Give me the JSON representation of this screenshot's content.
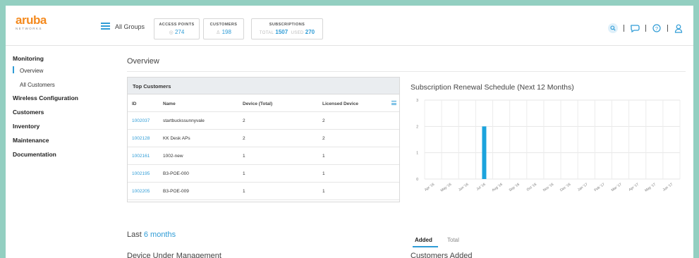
{
  "header": {
    "logo_text": "aruba",
    "logo_sub": "NETWORKS",
    "group_label": "All Groups",
    "stats": [
      {
        "title": "ACCESS POINTS",
        "value": "274"
      },
      {
        "title": "CUSTOMERS",
        "value": "198"
      },
      {
        "title": "SUBSCRIPTIONS",
        "total_label": "TOTAL",
        "total": "1507",
        "used_label": "USED",
        "used": "270"
      }
    ],
    "icons": [
      "search-icon",
      "chat-icon",
      "help-icon",
      "user-icon"
    ],
    "accent": "#2f9cd6",
    "brand": "#f48a1e"
  },
  "sidebar": {
    "sections": [
      {
        "label": "Monitoring",
        "items": [
          {
            "label": "Overview",
            "active": true
          },
          {
            "label": "All Customers",
            "active": false
          }
        ]
      },
      {
        "label": "Wireless Configuration",
        "items": []
      },
      {
        "label": "Customers",
        "items": []
      },
      {
        "label": "Inventory",
        "items": []
      },
      {
        "label": "Maintenance",
        "items": []
      },
      {
        "label": "Documentation",
        "items": []
      }
    ]
  },
  "main": {
    "title": "Overview",
    "top_customers": {
      "title": "Top Customers",
      "columns": [
        "ID",
        "Name",
        "Device (Total)",
        "Licensed Device"
      ],
      "rows": [
        [
          "1002037",
          "startbuckssunnyvale",
          "2",
          "2"
        ],
        [
          "1002128",
          "KK Desk APs",
          "2",
          "2"
        ],
        [
          "1002161",
          "1002-new",
          "1",
          "1"
        ],
        [
          "1002195",
          "B3-POE-000",
          "1",
          "1"
        ],
        [
          "1002205",
          "B3-POE-009",
          "1",
          "1"
        ]
      ]
    },
    "renewal_title": "Subscription Renewal Schedule (Next 12 Months)",
    "last_prefix": "Last",
    "last_value": "6 months",
    "device_title": "Device Under Management",
    "tabs": [
      "Added",
      "Total"
    ],
    "active_tab": "Added",
    "customers_added_title": "Customers Added"
  },
  "chart_data": {
    "type": "bar",
    "categories": [
      "Apr '16",
      "May '16",
      "Jun '16",
      "Jul '16",
      "Aug '16",
      "Sep '16",
      "Oct '16",
      "Nov '16",
      "Dec '16",
      "Jan '17",
      "Feb '17",
      "Mar '17",
      "Apr '17",
      "May '17",
      "Jun '17"
    ],
    "values": [
      0,
      0,
      0,
      2,
      0,
      0,
      0,
      0,
      0,
      0,
      0,
      0,
      0,
      0,
      0
    ],
    "y_ticks": [
      "0",
      "1",
      "2",
      "3"
    ],
    "ylim": [
      0,
      3
    ],
    "grid": true,
    "bar_color": "#1ba3dd"
  }
}
